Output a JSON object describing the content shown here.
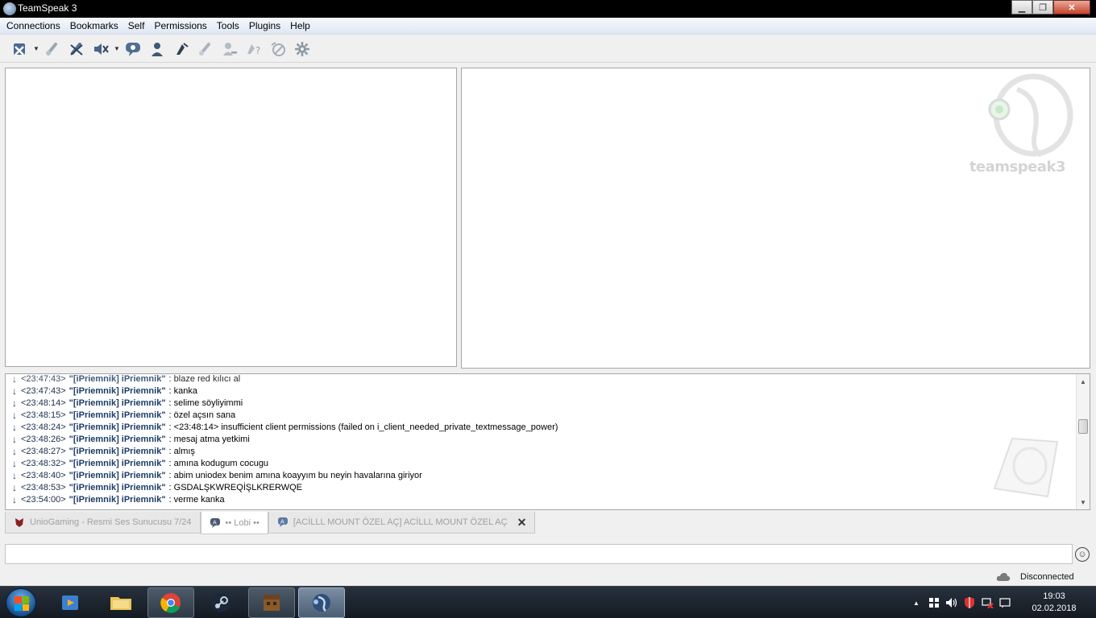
{
  "window": {
    "title": "TeamSpeak 3",
    "minimize_label": "▁",
    "maximize_label": "❐",
    "close_label": "✕"
  },
  "menu": [
    "Connections",
    "Bookmarks",
    "Self",
    "Permissions",
    "Tools",
    "Plugins",
    "Help"
  ],
  "toolbar_icons": [
    "disconnect-icon",
    "mute-microphone-icon",
    "mute-speakers-icon",
    "sound-off-icon",
    "chat-icon",
    "contacts-icon",
    "away-icon",
    "whisper-icon",
    "client-remove-icon",
    "request-talk-icon",
    "ban-icon",
    "settings-icon"
  ],
  "logo": {
    "text": "teamspeak3"
  },
  "chat": {
    "lines": [
      {
        "time": "<23:47:43>",
        "nick": "\"[iPriemnik] iPriemnik\"",
        "msg": ": blaze red kılıcı al"
      },
      {
        "time": "<23:47:43>",
        "nick": "\"[iPriemnik] iPriemnik\"",
        "msg": ": kanka"
      },
      {
        "time": "<23:48:14>",
        "nick": "\"[iPriemnik] iPriemnik\"",
        "msg": ": selime söyliyimmi"
      },
      {
        "time": "<23:48:15>",
        "nick": "\"[iPriemnik] iPriemnik\"",
        "msg": ": özel açsın sana"
      },
      {
        "time": "<23:48:24>",
        "nick": "\"[iPriemnik] iPriemnik\"",
        "msg": ": <23:48:14> insufficient client permissions (failed on i_client_needed_private_textmessage_power)"
      },
      {
        "time": "<23:48:26>",
        "nick": "\"[iPriemnik] iPriemnik\"",
        "msg": ": mesaj atma yetkimi"
      },
      {
        "time": "<23:48:27>",
        "nick": "\"[iPriemnik] iPriemnik\"",
        "msg": ": almış"
      },
      {
        "time": "<23:48:32>",
        "nick": "\"[iPriemnik] iPriemnik\"",
        "msg": ": amına kodugum cocugu"
      },
      {
        "time": "<23:48:40>",
        "nick": "\"[iPriemnik] iPriemnik\"",
        "msg": ": abim uniodex benim amına koayyım bu neyin havalarına giriyor"
      },
      {
        "time": "<23:48:53>",
        "nick": "\"[iPriemnik] iPriemnik\"",
        "msg": ": GSDALŞKWREQİŞLKRERWQE"
      },
      {
        "time": "<23:54:00>",
        "nick": "\"[iPriemnik] iPriemnik\"",
        "msg": ": verme kanka"
      }
    ]
  },
  "tabs": [
    {
      "label": "UnioGaming - Resmi Ses Sunucusu 7/24",
      "icon": "server-icon"
    },
    {
      "label": "•• Lobi ••",
      "icon": "channel-chat-icon"
    },
    {
      "label": "[ACİLLL MOUNT ÖZEL AÇ] ACİLLL MOUNT ÖZEL AÇ",
      "icon": "private-chat-icon",
      "close": "✕"
    }
  ],
  "input": {
    "value": "",
    "placeholder": ""
  },
  "status": {
    "connection": "Disconnected"
  },
  "taskbar": {
    "apps": [
      "media-player-icon",
      "file-explorer-icon",
      "chrome-icon",
      "steam-icon",
      "minecraft-icon",
      "teamspeak-icon"
    ],
    "tray": {
      "expand": "▲"
    },
    "clock": {
      "time": "19:03",
      "date": "02.02.2018"
    }
  }
}
